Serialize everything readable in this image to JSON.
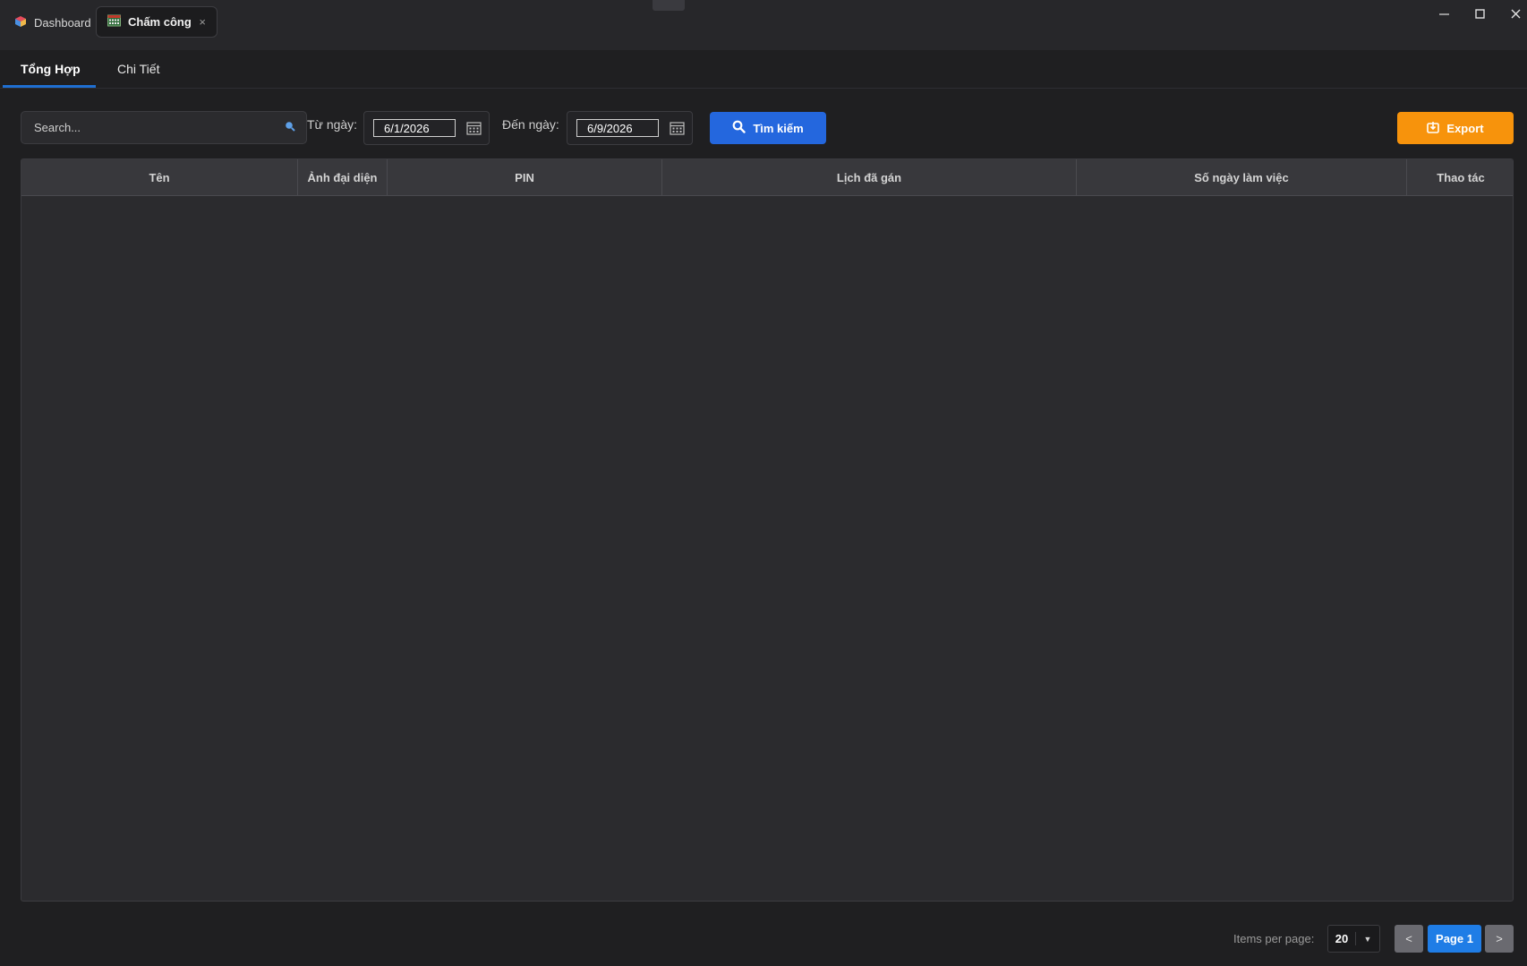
{
  "titlebar": {
    "tabs": [
      {
        "label": "Dashboard",
        "icon": "cube-logo-icon",
        "active": false
      },
      {
        "label": "Chấm công",
        "icon": "calendar-grid-icon",
        "active": true,
        "close": "×"
      }
    ],
    "window_controls": {
      "minimize": "—",
      "maximize": "▢",
      "close": "✕"
    }
  },
  "subtabs": [
    {
      "label": "Tổng Hợp",
      "active": true
    },
    {
      "label": "Chi Tiết",
      "active": false
    }
  ],
  "toolbar": {
    "search_placeholder": "Search...",
    "from_label": "Từ ngày:",
    "from_value": "6/1/2026",
    "to_label": "Đến ngày:",
    "to_value": "6/9/2026",
    "search_button": "Tìm kiếm",
    "export_button": "Export"
  },
  "table": {
    "columns": [
      "Tên",
      "Ảnh đại diện",
      "PIN",
      "Lịch đã gán",
      "Số ngày làm việc",
      "Thao tác"
    ],
    "rows": []
  },
  "pagination": {
    "items_per_page_label": "Items per page:",
    "items_per_page": "20",
    "prev": "<",
    "page": "Page 1",
    "next": ">"
  },
  "colors": {
    "primary": "#2467de",
    "export": "#f7930c",
    "page_active": "#1f7de6",
    "background": "#1f1f21"
  }
}
